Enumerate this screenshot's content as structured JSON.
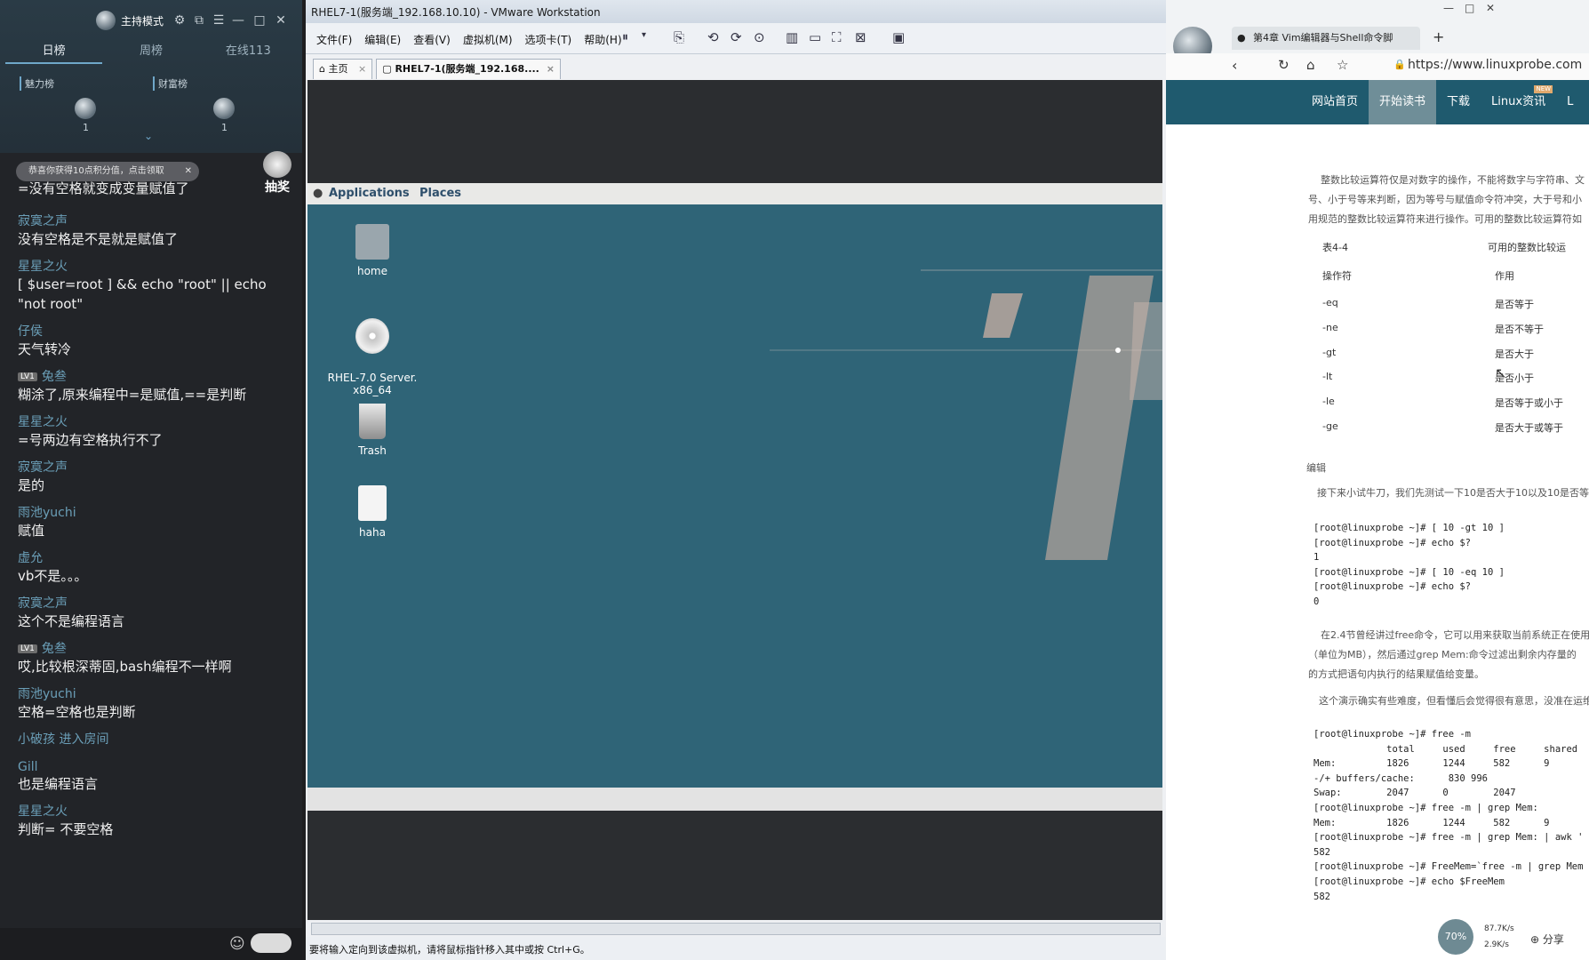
{
  "chat": {
    "host_label": "主持模式",
    "tabs": [
      "日榜",
      "周榜",
      "在线113"
    ],
    "rank_labels": [
      "魅力榜",
      "财富榜"
    ],
    "rank_counts": [
      "1",
      "1"
    ],
    "reward_banner": "恭喜你获得10点积分值，点击领取",
    "lottery_label": "抽奖",
    "first_message": "=没有空格就变成变量赋值了",
    "messages": [
      {
        "name": "寂寞之声",
        "lv": "",
        "text": "没有空格是不是就是赋值了"
      },
      {
        "name": "星星之火",
        "lv": "",
        "text": "[ $user=root ] && echo \"root\" || echo \"not root\""
      },
      {
        "name": "仔侯",
        "lv": "",
        "text": "天气转冷"
      },
      {
        "name": "兔叁",
        "lv": "LV1",
        "text": "糊涂了,原来编程中=是赋值,==是判断"
      },
      {
        "name": "星星之火",
        "lv": "",
        "text": "=号两边有空格执行不了"
      },
      {
        "name": "寂寞之声",
        "lv": "",
        "text": "是的"
      },
      {
        "name": "雨池yuchi",
        "lv": "",
        "text": "赋值"
      },
      {
        "name": "虚允",
        "lv": "",
        "text": "vb不是。。。"
      },
      {
        "name": "寂寞之声",
        "lv": "",
        "text": "这个不是编程语言"
      },
      {
        "name": "兔叁",
        "lv": "LV1",
        "text": "哎,比较根深蒂固,bash编程不一样啊"
      },
      {
        "name": "雨池yuchi",
        "lv": "",
        "text": "空格=空格也是判断"
      },
      {
        "name": "小破孩 进入房间",
        "lv": "",
        "text": ""
      },
      {
        "name": "Gill",
        "lv": "",
        "text": "也是编程语言"
      },
      {
        "name": "星星之火",
        "lv": "",
        "text": "判断= 不要空格"
      }
    ]
  },
  "vmware": {
    "title": "RHEL7-1(服务端_192.168.10.10) - VMware Workstation",
    "menus": [
      "文件(F)",
      "编辑(E)",
      "查看(V)",
      "虚拟机(M)",
      "选项卡(T)",
      "帮助(H)"
    ],
    "tabs": [
      "主页",
      "RHEL7-1(服务端_192.168...."
    ],
    "gnome_menu": [
      "Applications",
      "Places"
    ],
    "desktop_icons": [
      "home",
      "RHEL-7.0 Server.\nx86_64",
      "Trash",
      "haha"
    ],
    "status_text": "要将输入定向到该虚拟机，请将鼠标指针移入其中或按 Ctrl+G。"
  },
  "browser": {
    "tab_title": "第4章 Vim编辑器与Shell命令脚",
    "url": "https://www.linuxprobe.com",
    "nav": [
      "网站首页",
      "开始读书",
      "下载",
      "Linux资讯",
      "L"
    ],
    "nav_badge": "NEW",
    "intro": [
      "整数比较运算符仅是对数字的操作，不能将数字与字符串、文",
      "号、小于号等来判断，因为等号与赋值命令符冲突，大于号和小",
      "用规范的整数比较运算符来进行操作。可用的整数比较运算符如"
    ],
    "table_caption_left": "表4-4",
    "table_caption_right": "可用的整数比较运",
    "table_headers": [
      "操作符",
      "作用"
    ],
    "table_rows": [
      [
        "-eq",
        "是否等于"
      ],
      [
        "-ne",
        "是否不等于"
      ],
      [
        "-gt",
        "是否大于"
      ],
      [
        "-lt",
        "是否小于"
      ],
      [
        "-le",
        "是否等于或小于"
      ],
      [
        "-ge",
        "是否大于或等于"
      ]
    ],
    "edit_label": "编辑",
    "para2": "接下来小试牛刀，我们先测试一下10是否大于10以及10是否等",
    "code1": "[root@linuxprobe ~]# [ 10 -gt 10 ]\n[root@linuxprobe ~]# echo $?\n1\n[root@linuxprobe ~]# [ 10 -eq 10 ]\n[root@linuxprobe ~]# echo $?\n0",
    "para3": [
      "在2.4节曾经讲过free命令，它可以用来获取当前系统正在使用",
      "（单位为MB），然后通过grep Mem:命令过滤出剩余内存量的",
      "的方式把语句内执行的结果赋值给变量。"
    ],
    "para4": "这个演示确实有些难度，但看懂后会觉得很有意思，没准在运维",
    "code2": "[root@linuxprobe ~]# free -m\n             total     used     free     shared\nMem:         1826      1244     582      9\n-/+ buffers/cache:      830 996\nSwap:        2047      0        2047\n[root@linuxprobe ~]# free -m | grep Mem:\nMem:         1826      1244     582      9\n[root@linuxprobe ~]# free -m | grep Mem: | awk '\n582\n[root@linuxprobe ~]# FreeMem=`free -m | grep Mem\n[root@linuxprobe ~]# echo $FreeMem\n582",
    "share_label": "分享",
    "net_up": "87.7K/s",
    "net_down": "2.9K/s",
    "cpu_percent": "70%"
  }
}
